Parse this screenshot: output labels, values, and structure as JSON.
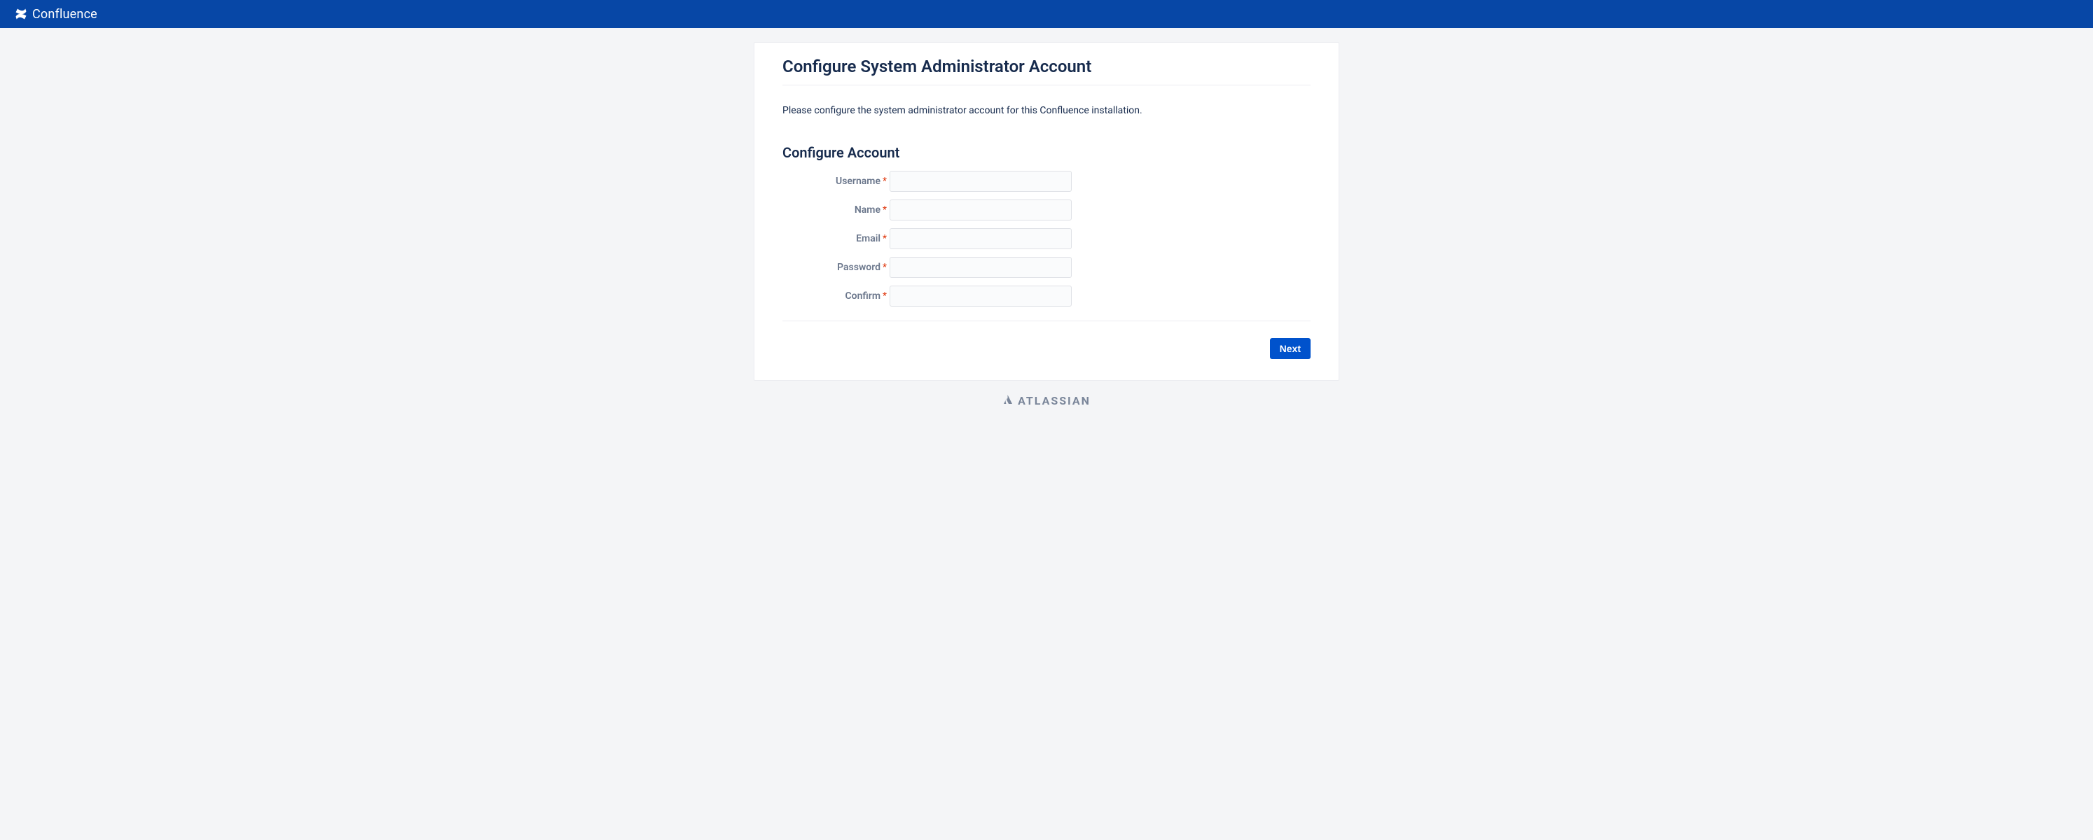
{
  "header": {
    "product_name": "Confluence"
  },
  "page": {
    "title": "Configure System Administrator Account",
    "description": "Please configure the system administrator account for this Confluence installation.",
    "section_title": "Configure Account"
  },
  "form": {
    "required_marker": "*",
    "fields": {
      "username": {
        "label": "Username",
        "value": ""
      },
      "name": {
        "label": "Name",
        "value": ""
      },
      "email": {
        "label": "Email",
        "value": ""
      },
      "password": {
        "label": "Password",
        "value": ""
      },
      "confirm": {
        "label": "Confirm",
        "value": ""
      }
    },
    "next_button": "Next"
  },
  "footer": {
    "vendor": "ATLASSIAN"
  }
}
